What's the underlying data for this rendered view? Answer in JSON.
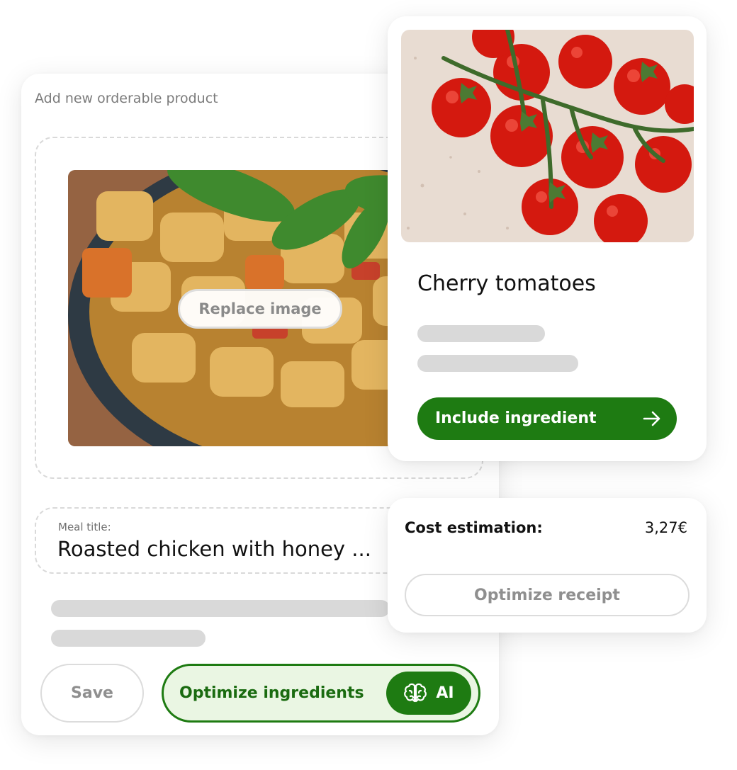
{
  "product_form": {
    "title": "Add new orderable product",
    "replace_image_label": "Replace image",
    "meal_title_label": "Meal title:",
    "meal_title_value": "Roasted chicken with honey ...",
    "save_label": "Save",
    "optimize_label": "Optimize ingredients",
    "ai_label": "AI",
    "ai_icon": "brain-icon"
  },
  "ingredient": {
    "name": "Cherry tomatoes",
    "include_label": "Include ingredient",
    "include_icon": "arrow-right-icon"
  },
  "cost": {
    "label": "Cost estimation:",
    "value": "3,27€",
    "optimize_receipt_label": "Optimize receipt"
  },
  "colors": {
    "accent_green": "#1e7b12",
    "accent_green_light": "#eaf6e3",
    "skeleton_gray": "#d9d9d9"
  }
}
